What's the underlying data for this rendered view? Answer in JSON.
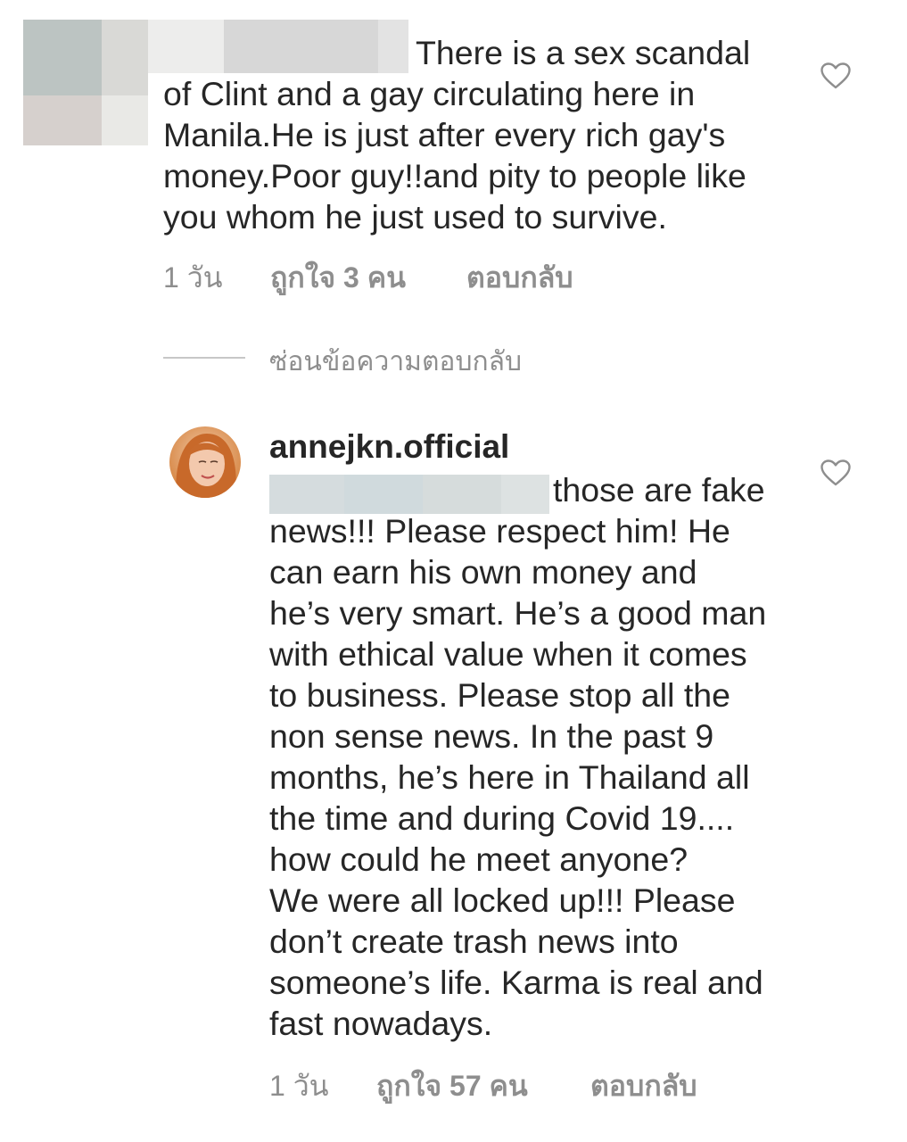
{
  "comment1": {
    "first_line": "There is a sex scandal",
    "rest": "of Clint and a gay circulating here in\nManila.He is just after every rich gay's\nmoney.Poor guy!!and pity to people like\nyou whom he just used to survive.",
    "time": "1 วัน",
    "likes": "ถูกใจ 3 คน",
    "reply": "ตอบกลับ"
  },
  "hide_replies": "ซ่อนข้อความตอบกลับ",
  "comment2": {
    "username": "annejkn.official",
    "first_line": "those are fake",
    "rest": "news!!! Please respect him! He\ncan earn his own money and\nhe’s very smart. He’s a good man\nwith ethical value when it comes\nto business. Please stop all the\nnon sense news. In the past 9\nmonths, he’s here in Thailand all\nthe time and during Covid 19....\nhow could he meet anyone?\nWe were all locked up!!! Please\ndon’t create trash news into\nsomeone’s life. Karma is real and\nfast nowadays.",
    "time": "1 วัน",
    "likes": "ถูกใจ 57 คน",
    "reply": "ตอบกลับ"
  },
  "icons": {
    "like": "heart-outline-icon",
    "avatar": "profile-avatar"
  },
  "colors": {
    "text": "#262626",
    "secondary": "#8e8e8e",
    "divider": "#c7c7c7"
  }
}
